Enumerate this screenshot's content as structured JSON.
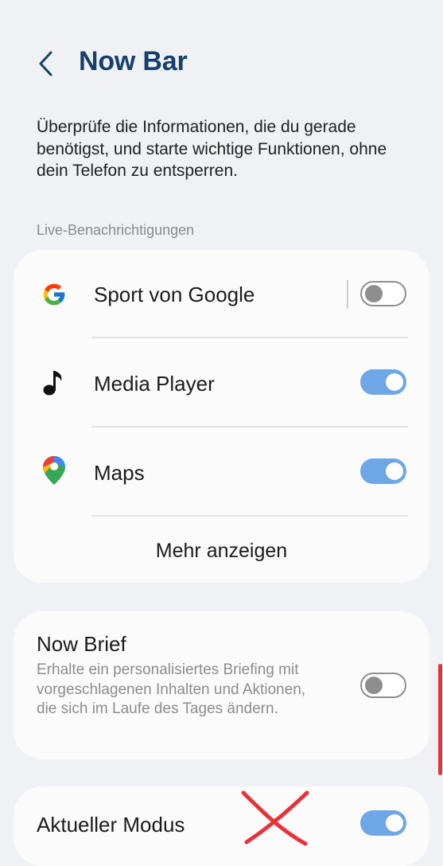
{
  "header": {
    "title": "Now Bar",
    "back_icon": "chevron-left-icon"
  },
  "intro_text": "Überprüfe die Informationen, die du gerade benötigst, und starte wichtige Funktionen, ohne dein Telefon zu entsperren.",
  "live_notifications": {
    "section_label": "Live-Benachrichtigungen",
    "items": [
      {
        "label": "Sport von Google",
        "icon": "google-g-icon",
        "enabled": false
      },
      {
        "label": "Media Player",
        "icon": "music-note-icon",
        "enabled": true
      },
      {
        "label": "Maps",
        "icon": "google-maps-pin-icon",
        "enabled": true
      }
    ],
    "more_label": "Mehr anzeigen"
  },
  "now_brief": {
    "title": "Now Brief",
    "description": "Erhalte ein personalisiertes Briefing mit vorgeschlagenen Inhalten und Aktionen, die sich im Laufe des Tages ändern.",
    "enabled": false
  },
  "current_mode": {
    "title": "Aktueller Modus",
    "enabled": true
  },
  "colors": {
    "background": "#eff1f4",
    "card": "#fbfbfb",
    "title": "#16406b",
    "toggle_on": "#6ea6e8",
    "toggle_off": "#8e8e8e",
    "annotation_red": "#e8323a"
  }
}
